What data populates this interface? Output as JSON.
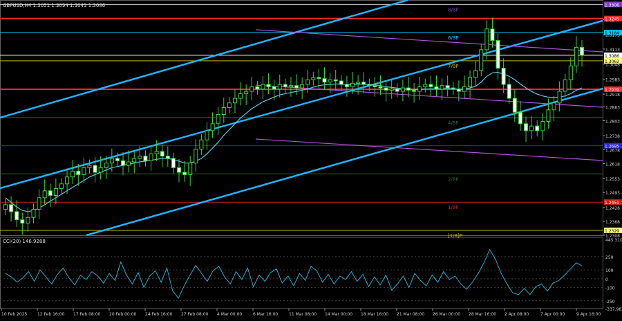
{
  "chart_data": [
    {
      "type": "candlestick",
      "title": "GBPUSD,H4 1.3051 1.3094 1.3043 1.3086",
      "ylim": [
        1.2308,
        1.3325
      ],
      "price_ticks": [
        "1.3240",
        "1.3175",
        "1.3113",
        "1.3048",
        "1.2983",
        "1.2918",
        "1.2863",
        "1.2803",
        "1.2738",
        "1.2678",
        "1.2618",
        "1.2553",
        "1.2493",
        "1.2428",
        "1.2368",
        "1.2308"
      ],
      "time_labels": [
        "10 Feb 2025",
        "12 Feb 16:00",
        "17 Feb 08:00",
        "20 Feb 00:00",
        "24 Feb 16:00",
        "27 Feb 08:00",
        "4 Mar 00:00",
        "6 Mar 16:00",
        "11 Mar 08:00",
        "14 Mar 00:00",
        "18 Mar 16:00",
        "21 Mar 08:00",
        "26 Mar 00:00",
        "28 Mar 16:00",
        "2 Apr 08:00",
        "7 Apr 00:00",
        "9 Apr 16:00"
      ],
      "level_lines": [
        {
          "price": 1.3306,
          "label": "8/8P",
          "tag": "1.3306",
          "color": "#d0d0d0",
          "tag_color": "#7e3fbf"
        },
        {
          "price": 1.3245,
          "label": "",
          "tag": "1.3245",
          "color": "#ff2a2a",
          "tag_color": "#ff2a2a"
        },
        {
          "price": 1.3184,
          "label": "6/8P",
          "tag": "1.3184",
          "color": "#00c8ff",
          "tag_color": "#00c8ff"
        },
        {
          "price": 1.3086,
          "label": "",
          "tag": "1.3086",
          "color": "#ffffff",
          "tag_color": "#ffffff"
        },
        {
          "price": 1.3062,
          "label": "7/8P",
          "tag": "1.3062",
          "color": "#c8b400",
          "tag_color": "#ffff80"
        },
        {
          "price": 1.2939,
          "label": "",
          "tag": "1.2939",
          "color": "#ff2a2a",
          "tag_color": "#ff2a2a"
        },
        {
          "price": 1.2817,
          "label": "4/8P",
          "tag": "",
          "color": "#2f6a2f",
          "tag_color": ""
        },
        {
          "price": 1.2695,
          "label": "",
          "tag": "1.2695",
          "color": "#2a2ad0",
          "tag_color": "#2a2ad0"
        },
        {
          "price": 1.2573,
          "label": "2/8P",
          "tag": "",
          "color": "#2f6a2f",
          "tag_color": ""
        },
        {
          "price": 1.2451,
          "label": "1/8P",
          "tag": "1.2451",
          "color": "#cc2020",
          "tag_color": "#cc2020"
        },
        {
          "price": 1.2329,
          "label": "[1/8]P",
          "tag": "1.2329",
          "color": "#c8b400",
          "tag_color": "#ffff80"
        }
      ],
      "close_series": [
        1.244,
        1.241,
        1.2375,
        1.236,
        1.2385,
        1.242,
        1.247,
        1.25,
        1.248,
        1.251,
        1.253,
        1.256,
        1.2585,
        1.257,
        1.26,
        1.261,
        1.258,
        1.26,
        1.262,
        1.264,
        1.263,
        1.261,
        1.2625,
        1.264,
        1.265,
        1.263,
        1.266,
        1.267,
        1.265,
        1.264,
        1.26,
        1.258,
        1.257,
        1.262,
        1.268,
        1.272,
        1.276,
        1.279,
        1.283,
        1.286,
        1.288,
        1.29,
        1.292,
        1.293,
        1.295,
        1.294,
        1.296,
        1.295,
        1.294,
        1.296,
        1.295,
        1.2955,
        1.2945,
        1.296,
        1.298,
        1.299,
        1.2985,
        1.297,
        1.298,
        1.2975,
        1.296,
        1.295,
        1.2965,
        1.297,
        1.296,
        1.2955,
        1.295,
        1.2945,
        1.2935,
        1.294,
        1.293,
        1.2945,
        1.2935,
        1.293,
        1.295,
        1.296,
        1.295,
        1.294,
        1.2955,
        1.2945,
        1.294,
        1.293,
        1.295,
        1.299,
        1.302,
        1.311,
        1.32,
        1.315,
        1.303,
        1.296,
        1.29,
        1.284,
        1.279,
        1.276,
        1.278,
        1.276,
        1.28,
        1.285,
        1.288,
        1.293,
        1.298,
        1.304,
        1.312,
        1.3086
      ],
      "ma_series": [
        1.247,
        1.245,
        1.243,
        1.2415,
        1.241,
        1.2415,
        1.2425,
        1.244,
        1.2455,
        1.247,
        1.2485,
        1.25,
        1.2515,
        1.253,
        1.2545,
        1.256,
        1.257,
        1.258,
        1.259,
        1.26,
        1.2605,
        1.261,
        1.2615,
        1.262,
        1.2625,
        1.2628,
        1.2632,
        1.2636,
        1.264,
        1.264,
        1.2635,
        1.2628,
        1.262,
        1.262,
        1.2628,
        1.264,
        1.266,
        1.2685,
        1.271,
        1.274,
        1.2765,
        1.279,
        1.2815,
        1.2835,
        1.2855,
        1.287,
        1.2885,
        1.2895,
        1.2905,
        1.2915,
        1.292,
        1.2925,
        1.293,
        1.2935,
        1.294,
        1.2948,
        1.2955,
        1.2958,
        1.296,
        1.2962,
        1.2962,
        1.296,
        1.296,
        1.2961,
        1.2961,
        1.296,
        1.2958,
        1.2955,
        1.295,
        1.2947,
        1.2944,
        1.2942,
        1.294,
        1.2938,
        1.2938,
        1.294,
        1.2941,
        1.2941,
        1.2942,
        1.2942,
        1.2941,
        1.294,
        1.294,
        1.2945,
        1.2952,
        1.297,
        1.2995,
        1.301,
        1.3012,
        1.3005,
        1.2995,
        1.298,
        1.2962,
        1.2945,
        1.293,
        1.2918,
        1.291,
        1.2905,
        1.2903,
        1.2905,
        1.291,
        1.292,
        1.2935,
        1.2945
      ]
    },
    {
      "type": "line",
      "title": "CCI(20) 146.9288",
      "ylim": [
        -337.982,
        445.31
      ],
      "tick_labels": [
        "445.3108",
        "250",
        "100",
        "0",
        "-100",
        "-250",
        "-337.982"
      ],
      "values": [
        60,
        20,
        -40,
        10,
        80,
        -30,
        100,
        20,
        -60,
        50,
        120,
        10,
        -70,
        40,
        -10,
        80,
        30,
        -50,
        60,
        -20,
        190,
        40,
        -60,
        70,
        -100,
        30,
        90,
        -40,
        120,
        -140,
        -220,
        -80,
        40,
        150,
        60,
        -30,
        90,
        140,
        20,
        -60,
        80,
        -10,
        120,
        -90,
        40,
        -30,
        70,
        110,
        -50,
        30,
        -80,
        60,
        -20,
        140,
        90,
        -40,
        50,
        -60,
        30,
        -10,
        80,
        -30,
        50,
        -90,
        20,
        -70,
        40,
        -130,
        -60,
        30,
        -100,
        60,
        -20,
        -80,
        40,
        -40,
        80,
        -10,
        30,
        -60,
        -120,
        -40,
        60,
        180,
        330,
        220,
        60,
        -60,
        -160,
        -180,
        -110,
        -180,
        -90,
        -60,
        -140,
        -50,
        -20,
        40,
        110,
        180,
        146.93
      ]
    }
  ]
}
